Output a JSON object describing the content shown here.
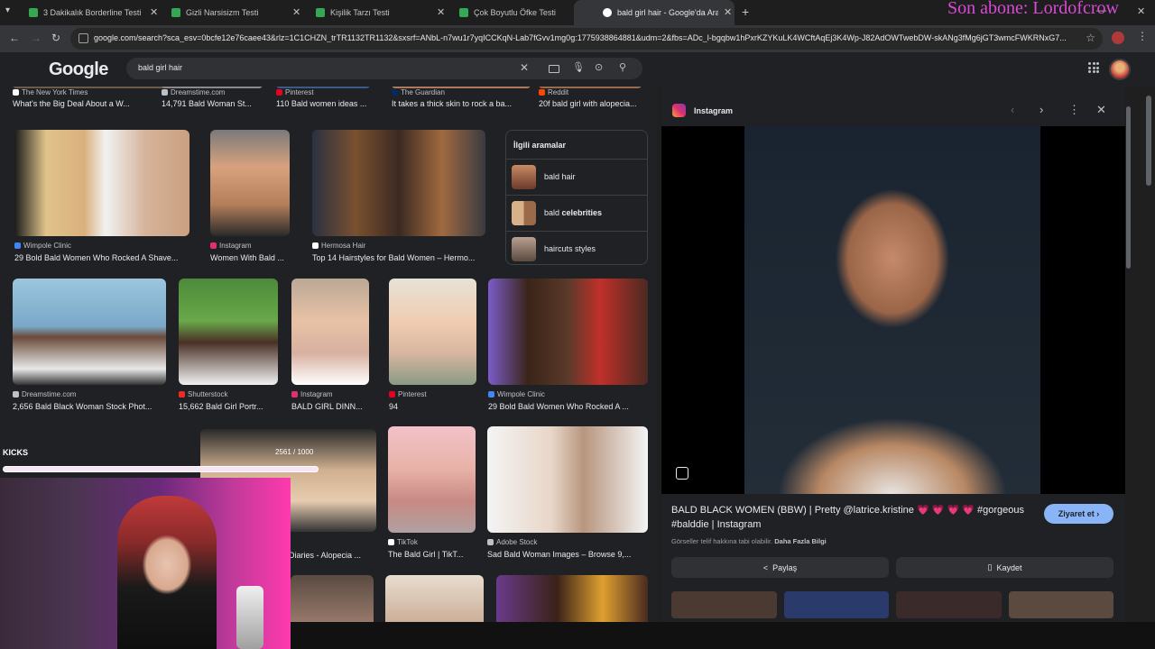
{
  "browser": {
    "tabs": [
      {
        "title": "3 Dakikalık Borderline Testi",
        "fav_color": "#34a853"
      },
      {
        "title": "Gizli Narsisizm Testi",
        "fav_color": "#34a853"
      },
      {
        "title": "Kişilik Tarzı Testi",
        "fav_color": "#34a853"
      },
      {
        "title": "Çok Boyutlu Öfke Testi",
        "fav_color": "#34a853"
      },
      {
        "title": "bald girl hair - Google'da Ara",
        "fav_color": "#ffffff"
      }
    ],
    "new_tab": "+",
    "close_glyph": "✕",
    "url": "google.com/search?sca_esv=0bcfe12e76caee43&rlz=1C1CHZN_trTR1132TR1132&sxsrf=ANbL-n7wu1r7yqICCKqN-Lab7fGvv1mg0g:1775938864881&udm=2&fbs=ADc_l-bgqbw1hPxrKZYKuLK4WCftAqEj3K4Wp-J82AdOWTwebDW-skANg3fMg6jGT3wmcFWKRNxG7..."
  },
  "stream_overlay": {
    "last_sub": "Son abone: Lordofcrow",
    "kicks_label": "KICKS",
    "kicks_count": "2561 / 1000"
  },
  "google": {
    "logo": "Google",
    "query": "bald girl hair"
  },
  "results": {
    "row0": [
      {
        "source": "The New York Times",
        "caption": "What's the Big Deal About a W...",
        "fav": "#ffffff"
      },
      {
        "source": "Dreamstime.com",
        "caption": "14,791 Bald Woman St...",
        "fav": "#bdc1c6"
      },
      {
        "source": "Pinterest",
        "caption": "110 Bald women ideas ...",
        "fav": "#e60023"
      },
      {
        "source": "The Guardian",
        "caption": "It takes a thick skin to rock a ba...",
        "fav": "#052962"
      },
      {
        "source": "Reddit",
        "caption": "20f bald girl with alopecia...",
        "fav": "#ff4500"
      }
    ],
    "row1": [
      {
        "source": "Wimpole Clinic",
        "caption": "29 Bold Bald Women Who Rocked A Shave...",
        "fav": "#4285f4"
      },
      {
        "source": "Instagram",
        "caption": "Women With Bald ...",
        "fav": "#e1306c"
      },
      {
        "source": "Hermosa Hair",
        "caption": "Top 14 Hairstyles for Bald Women – Hermo...",
        "fav": "#ffffff"
      }
    ],
    "row2": [
      {
        "source": "Dreamstime.com",
        "caption": "2,656 Bald Black Woman Stock Phot...",
        "fav": "#bdc1c6"
      },
      {
        "source": "Shutterstock",
        "caption": "15,662 Bald Girl Portr...",
        "fav": "#ee2b24"
      },
      {
        "source": "Instagram",
        "caption": "BALD GIRL DINN...",
        "fav": "#e1306c"
      },
      {
        "source": "Pinterest",
        "caption": "94",
        "fav": "#e60023"
      },
      {
        "source": "Wimpole Clinic",
        "caption": "29 Bold Bald Women Who Rocked A ...",
        "fav": "#4285f4"
      }
    ],
    "row3": [
      {
        "source": "",
        "caption": "Diaries - Alopecia ...",
        "fav": ""
      },
      {
        "source": "TikTok",
        "caption": "The Bald Girl | TikT...",
        "fav": "#ffffff"
      },
      {
        "source": "Adobe Stock",
        "caption": "Sad Bald Woman Images – Browse 9,...",
        "fav": "#bdc1c6"
      }
    ]
  },
  "related": {
    "title": "İlgili aramalar",
    "items": [
      {
        "pre": "bald hair",
        "bold": ""
      },
      {
        "pre": "bald ",
        "bold": "celebrities"
      },
      {
        "pre": "haircuts styles",
        "bold": ""
      }
    ]
  },
  "panel": {
    "source": "Instagram",
    "title": "BALD BLACK WOMEN (BBW) | Pretty @latrice.kristine 💗 💗 💗 💗 #gorgeous #balddie | Instagram",
    "visit_label": "Ziyaret et",
    "copyright": "Görseller telif hakkına tabi olabilir.",
    "more_info": "Daha Fazla Bilgi",
    "share_label": "Paylaş",
    "save_label": "Kaydet"
  },
  "colors": {
    "accent_blue": "#8ab4f8",
    "overlay_pink": "#d94bd6"
  }
}
